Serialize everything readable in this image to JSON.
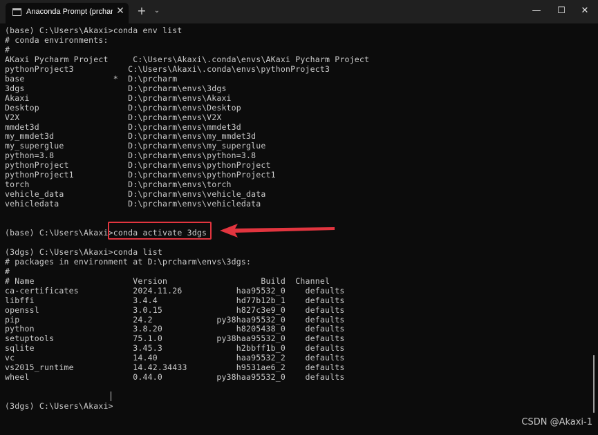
{
  "window": {
    "tab_title": "Anaconda Prompt (prcharm) ·",
    "tab_close_glyph": "✕",
    "new_tab_glyph": "+",
    "dropdown_glyph": "⌄",
    "minimize_glyph": "—",
    "maximize_glyph": "☐",
    "close_glyph": "✕"
  },
  "terminal": {
    "lines": [
      "(base) C:\\Users\\Akaxi>conda env list",
      "# conda environments:",
      "#",
      "AKaxi Pycharm Project     C:\\Users\\Akaxi\\.conda\\envs\\AKaxi Pycharm Project",
      "pythonProject3           C:\\Users\\Akaxi\\.conda\\envs\\pythonProject3",
      "base                  *  D:\\prcharm",
      "3dgs                     D:\\prcharm\\envs\\3dgs",
      "Akaxi                    D:\\prcharm\\envs\\Akaxi",
      "Desktop                  D:\\prcharm\\envs\\Desktop",
      "V2X                      D:\\prcharm\\envs\\V2X",
      "mmdet3d                  D:\\prcharm\\envs\\mmdet3d",
      "my_mmdet3d               D:\\prcharm\\envs\\my_mmdet3d",
      "my_superglue             D:\\prcharm\\envs\\my_superglue",
      "python=3.8               D:\\prcharm\\envs\\python=3.8",
      "pythonProject            D:\\prcharm\\envs\\pythonProject",
      "pythonProject1           D:\\prcharm\\envs\\pythonProject1",
      "torch                    D:\\prcharm\\envs\\torch",
      "vehicle_data             D:\\prcharm\\envs\\vehicle_data",
      "vehicledata              D:\\prcharm\\envs\\vehicledata",
      "",
      "",
      "(base) C:\\Users\\Akaxi>conda activate 3dgs",
      "",
      "(3dgs) C:\\Users\\Akaxi>conda list",
      "# packages in environment at D:\\prcharm\\envs\\3dgs:",
      "#",
      "# Name                    Version                   Build  Channel",
      "ca-certificates           2024.11.26           haa95532_0    defaults",
      "libffi                    3.4.4                hd77b12b_1    defaults",
      "openssl                   3.0.15               h827c3e9_0    defaults",
      "pip                       24.2             py38haa95532_0    defaults",
      "python                    3.8.20               h8205438_0    defaults",
      "setuptools                75.1.0           py38haa95532_0    defaults",
      "sqlite                    3.45.3               h2bbff1b_0    defaults",
      "vc                        14.40                haa95532_2    defaults",
      "vs2015_runtime            14.42.34433          h9531ae6_2    defaults",
      "wheel                     0.44.0           py38haa95532_0    defaults",
      "",
      "",
      "(3dgs) C:\\Users\\Akaxi>"
    ]
  },
  "annotation": {
    "highlight_color": "#e2353f",
    "arrow_icon": "arrow-left-icon"
  },
  "watermark": "CSDN @Akaxi-1"
}
